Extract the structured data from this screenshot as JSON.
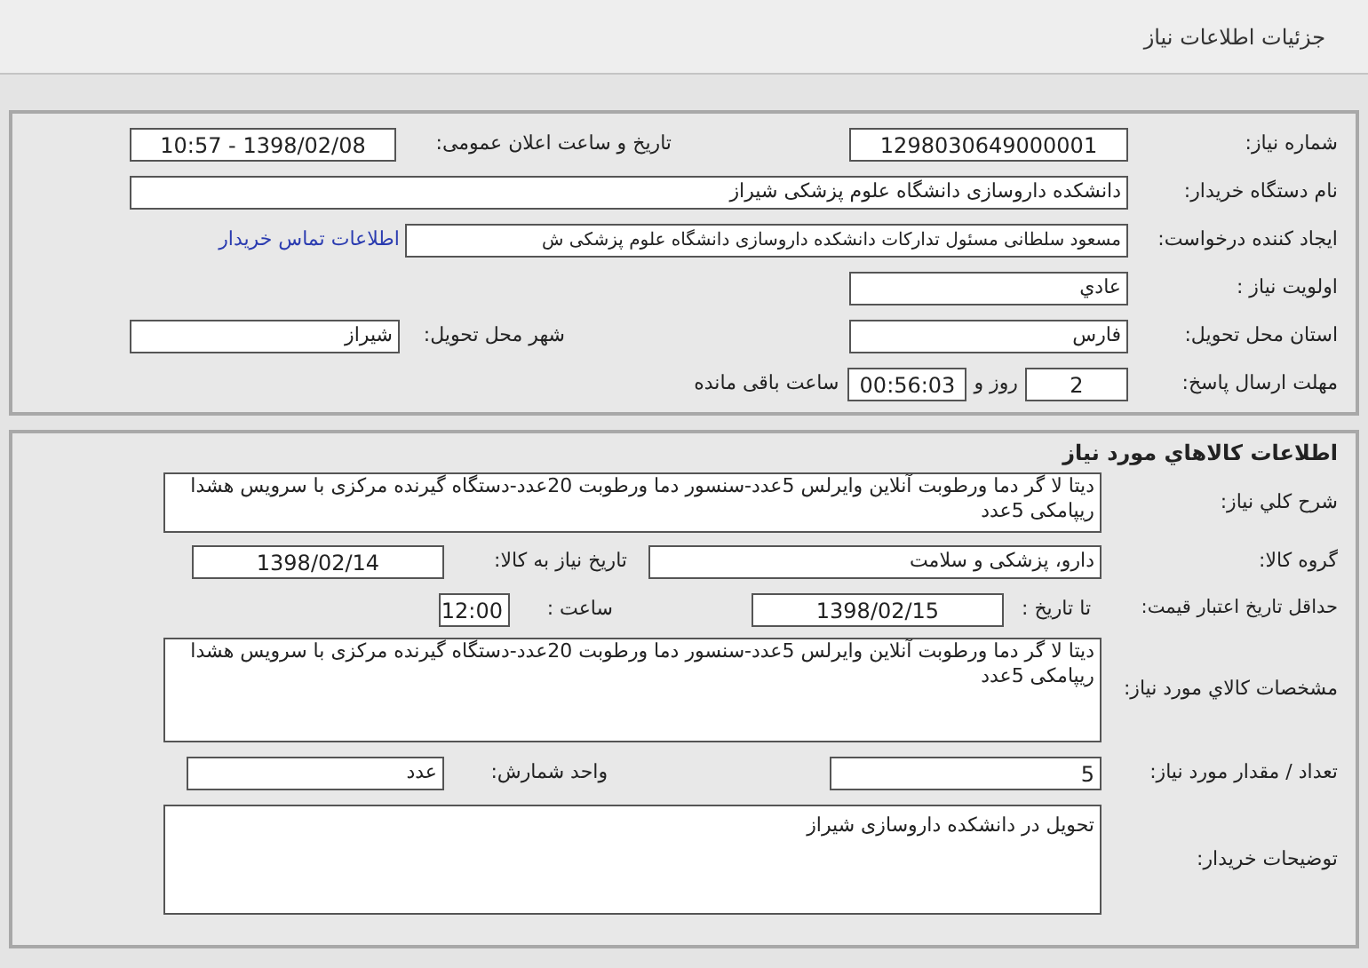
{
  "header": {
    "title": "جزئیات اطلاعات نیاز"
  },
  "need_info": {
    "need_number": {
      "label": "شماره نیاز:",
      "value": "1298030649000001"
    },
    "announce": {
      "label": "تاریخ و ساعت اعلان عمومی:",
      "value": "1398/02/08 - 10:57"
    },
    "buyer_org": {
      "label": "نام دستگاه خریدار:",
      "value": "دانشکده داروسازی دانشگاه علوم پزشکی شیراز"
    },
    "requester": {
      "label": "ایجاد کننده درخواست:",
      "value": "مسعود سلطانی  مسئول تدارکات  دانشکده داروسازی دانشگاه علوم پزشکی ش",
      "link": "اطلاعات تماس خریدار"
    },
    "priority": {
      "label": "اولویت نیاز :",
      "value": "عادي"
    },
    "province": {
      "label": "استان محل تحویل:",
      "value": "فارس"
    },
    "city": {
      "label": "شهر محل تحویل:",
      "value": "شیراز"
    },
    "deadline": {
      "label": "مهلت ارسال پاسخ:",
      "days": "2",
      "days_unit": "روز و",
      "time": "00:56:03",
      "time_suffix": "ساعت باقی مانده"
    }
  },
  "goods": {
    "title": "اطلاعات کالاهاي مورد نياز",
    "description": {
      "label": "شرح کلي نیاز:",
      "value": "دیتا لا گر دما ورطوبت آنلاین وایرلس 5عدد-سنسور دما ورطوبت 20عدد-دستگاه گیرنده مرکزی با سرویس هشدا ریپامکی 5عدد"
    },
    "group": {
      "label": "گروه کالا:",
      "value": "دارو، پزشکی و سلامت"
    },
    "need_date": {
      "label": "تاریخ نیاز به کالا:",
      "value": "1398/02/14"
    },
    "price_validity": {
      "label": "حداقل تاریخ اعتبار قیمت:",
      "to_date_label": "تا تاریخ :",
      "date": "1398/02/15",
      "time_label": "ساعت :",
      "time": "12:00"
    },
    "specs": {
      "label": "مشخصات کالاي مورد نياز:",
      "value": "دیتا لا گر دما ورطوبت آنلاین وایرلس 5عدد-سنسور دما ورطوبت 20عدد-دستگاه گیرنده مرکزی با سرویس هشدا ریپامکی 5عدد"
    },
    "quantity": {
      "label": "تعداد / مقدار مورد نیاز:",
      "value": "5"
    },
    "unit": {
      "label": "واحد شمارش:",
      "value": "عدد"
    },
    "notes": {
      "label": "توضیحات خریدار:",
      "value": "تحویل در دانشکده داروسازی شیراز"
    }
  }
}
